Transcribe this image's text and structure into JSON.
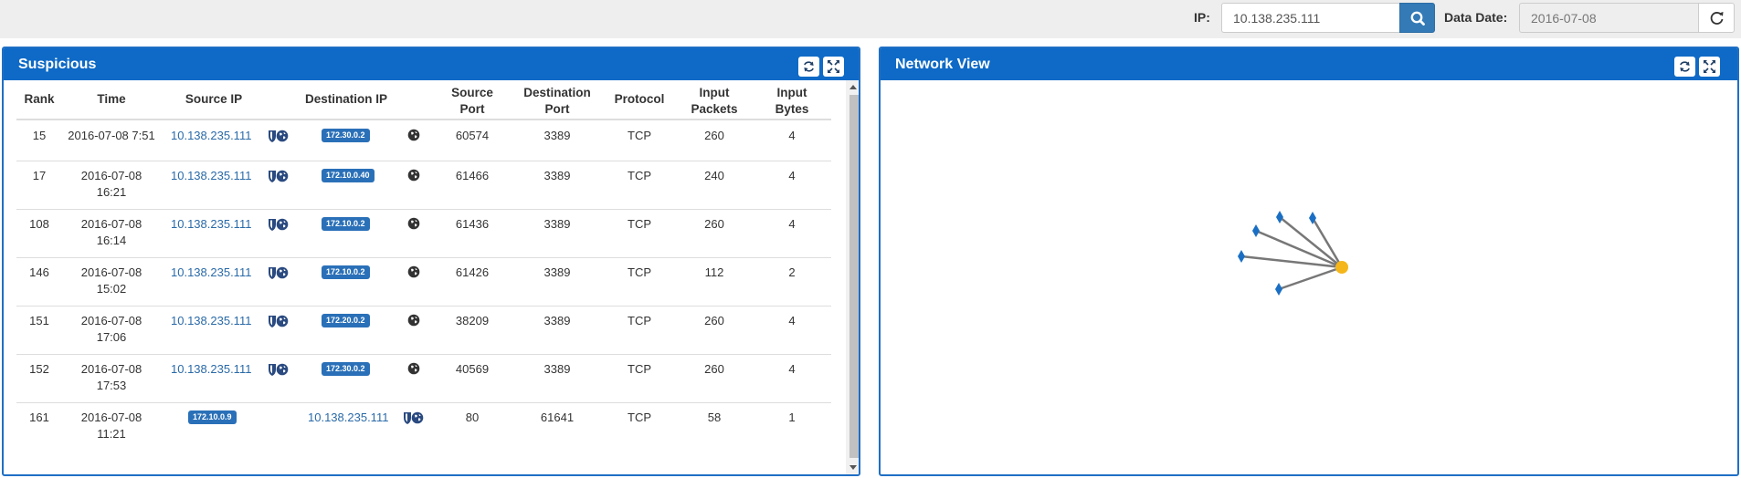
{
  "toolbar": {
    "ip_label": "IP:",
    "ip_value": "10.138.235.111",
    "date_label": "Data Date:",
    "date_value": "2016-07-08"
  },
  "suspicious": {
    "title": "Suspicious",
    "columns": [
      "Rank",
      "Time",
      "Source IP",
      "Destination IP",
      "Source Port",
      "Destination Port",
      "Protocol",
      "Input Packets",
      "Input Bytes"
    ],
    "rows": [
      {
        "rank": "15",
        "time1": "2016-07-08 7:51",
        "time2": "",
        "src": "10.138.235.111",
        "src_type": "link",
        "dst": "172.30.0.2",
        "dst_type": "badge",
        "sport": "60574",
        "dport": "3389",
        "proto": "TCP",
        "pkts": "260",
        "bytes": "4"
      },
      {
        "rank": "17",
        "time1": "2016-07-08",
        "time2": "16:21",
        "src": "10.138.235.111",
        "src_type": "link",
        "dst": "172.10.0.40",
        "dst_type": "badge",
        "sport": "61466",
        "dport": "3389",
        "proto": "TCP",
        "pkts": "240",
        "bytes": "4"
      },
      {
        "rank": "108",
        "time1": "2016-07-08",
        "time2": "16:14",
        "src": "10.138.235.111",
        "src_type": "link",
        "dst": "172.10.0.2",
        "dst_type": "badge",
        "sport": "61436",
        "dport": "3389",
        "proto": "TCP",
        "pkts": "260",
        "bytes": "4"
      },
      {
        "rank": "146",
        "time1": "2016-07-08",
        "time2": "15:02",
        "src": "10.138.235.111",
        "src_type": "link",
        "dst": "172.10.0.2",
        "dst_type": "badge",
        "sport": "61426",
        "dport": "3389",
        "proto": "TCP",
        "pkts": "112",
        "bytes": "2"
      },
      {
        "rank": "151",
        "time1": "2016-07-08",
        "time2": "17:06",
        "src": "10.138.235.111",
        "src_type": "link",
        "dst": "172.20.0.2",
        "dst_type": "badge",
        "sport": "38209",
        "dport": "3389",
        "proto": "TCP",
        "pkts": "260",
        "bytes": "4"
      },
      {
        "rank": "152",
        "time1": "2016-07-08",
        "time2": "17:53",
        "src": "10.138.235.111",
        "src_type": "link",
        "dst": "172.30.0.2",
        "dst_type": "badge",
        "sport": "40569",
        "dport": "3389",
        "proto": "TCP",
        "pkts": "260",
        "bytes": "4"
      },
      {
        "rank": "161",
        "time1": "2016-07-08",
        "time2": "11:21",
        "src": "172.10.0.9",
        "src_type": "badge",
        "dst": "10.138.235.111",
        "dst_type": "link",
        "sport": "80",
        "dport": "61641",
        "proto": "TCP",
        "pkts": "58",
        "bytes": "1"
      }
    ]
  },
  "network_view": {
    "title": "Network View",
    "colors": {
      "center": "#f5b61b",
      "leaf": "#1a6fc4",
      "edge": "#777777"
    }
  },
  "icons": {
    "search": "search-icon",
    "refresh": "refresh-icon",
    "fullscreen": "fullscreen-icon",
    "globe": "globe-icon",
    "shield_globe": "shield-globe-icon"
  },
  "colors": {
    "panel_header": "#0e6ac6",
    "badge": "#2a70b8",
    "link": "#2a6aa8",
    "search_button": "#337ab7"
  }
}
